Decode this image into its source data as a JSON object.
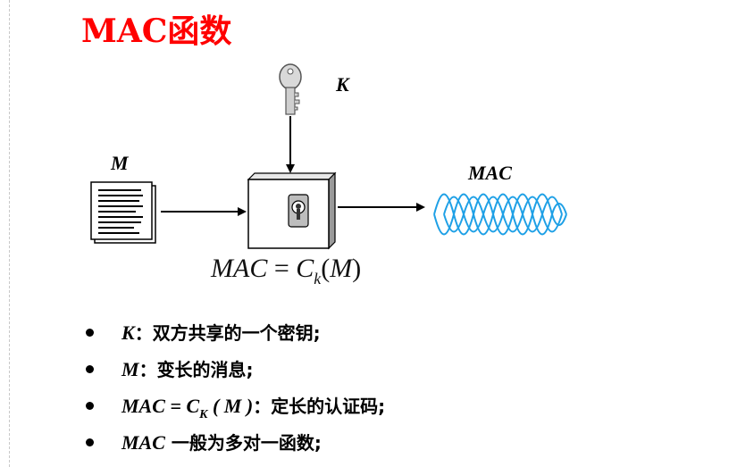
{
  "title": "MAC函数",
  "diagram": {
    "key_label": "K",
    "message_label": "M",
    "output_label": "MAC",
    "formula": {
      "lhs": "MAC",
      "eq": "=",
      "func": "C",
      "sub": "k",
      "open": "(",
      "arg": "M",
      "close": ")"
    },
    "icons": {
      "key": "key-icon",
      "document": "document-icon",
      "box": "cipher-box",
      "keyhole": "keyhole-icon",
      "waveform": "waveform-icon"
    },
    "colors": {
      "title": "#ff0000",
      "waveform": "#1ea0e6"
    }
  },
  "bullets": [
    {
      "sym": "K",
      "sep": "：",
      "text": "双方共享的一个密钥;"
    },
    {
      "sym": "M",
      "sep": "：",
      "text": "变长的消息;"
    },
    {
      "sym": "MAC = C",
      "sub": "K",
      "tail": " ( M )",
      "sep": "：",
      "text": "定长的认证码;"
    },
    {
      "sym": "MAC",
      "sep": " ",
      "text": "一般为多对一函数;"
    }
  ]
}
